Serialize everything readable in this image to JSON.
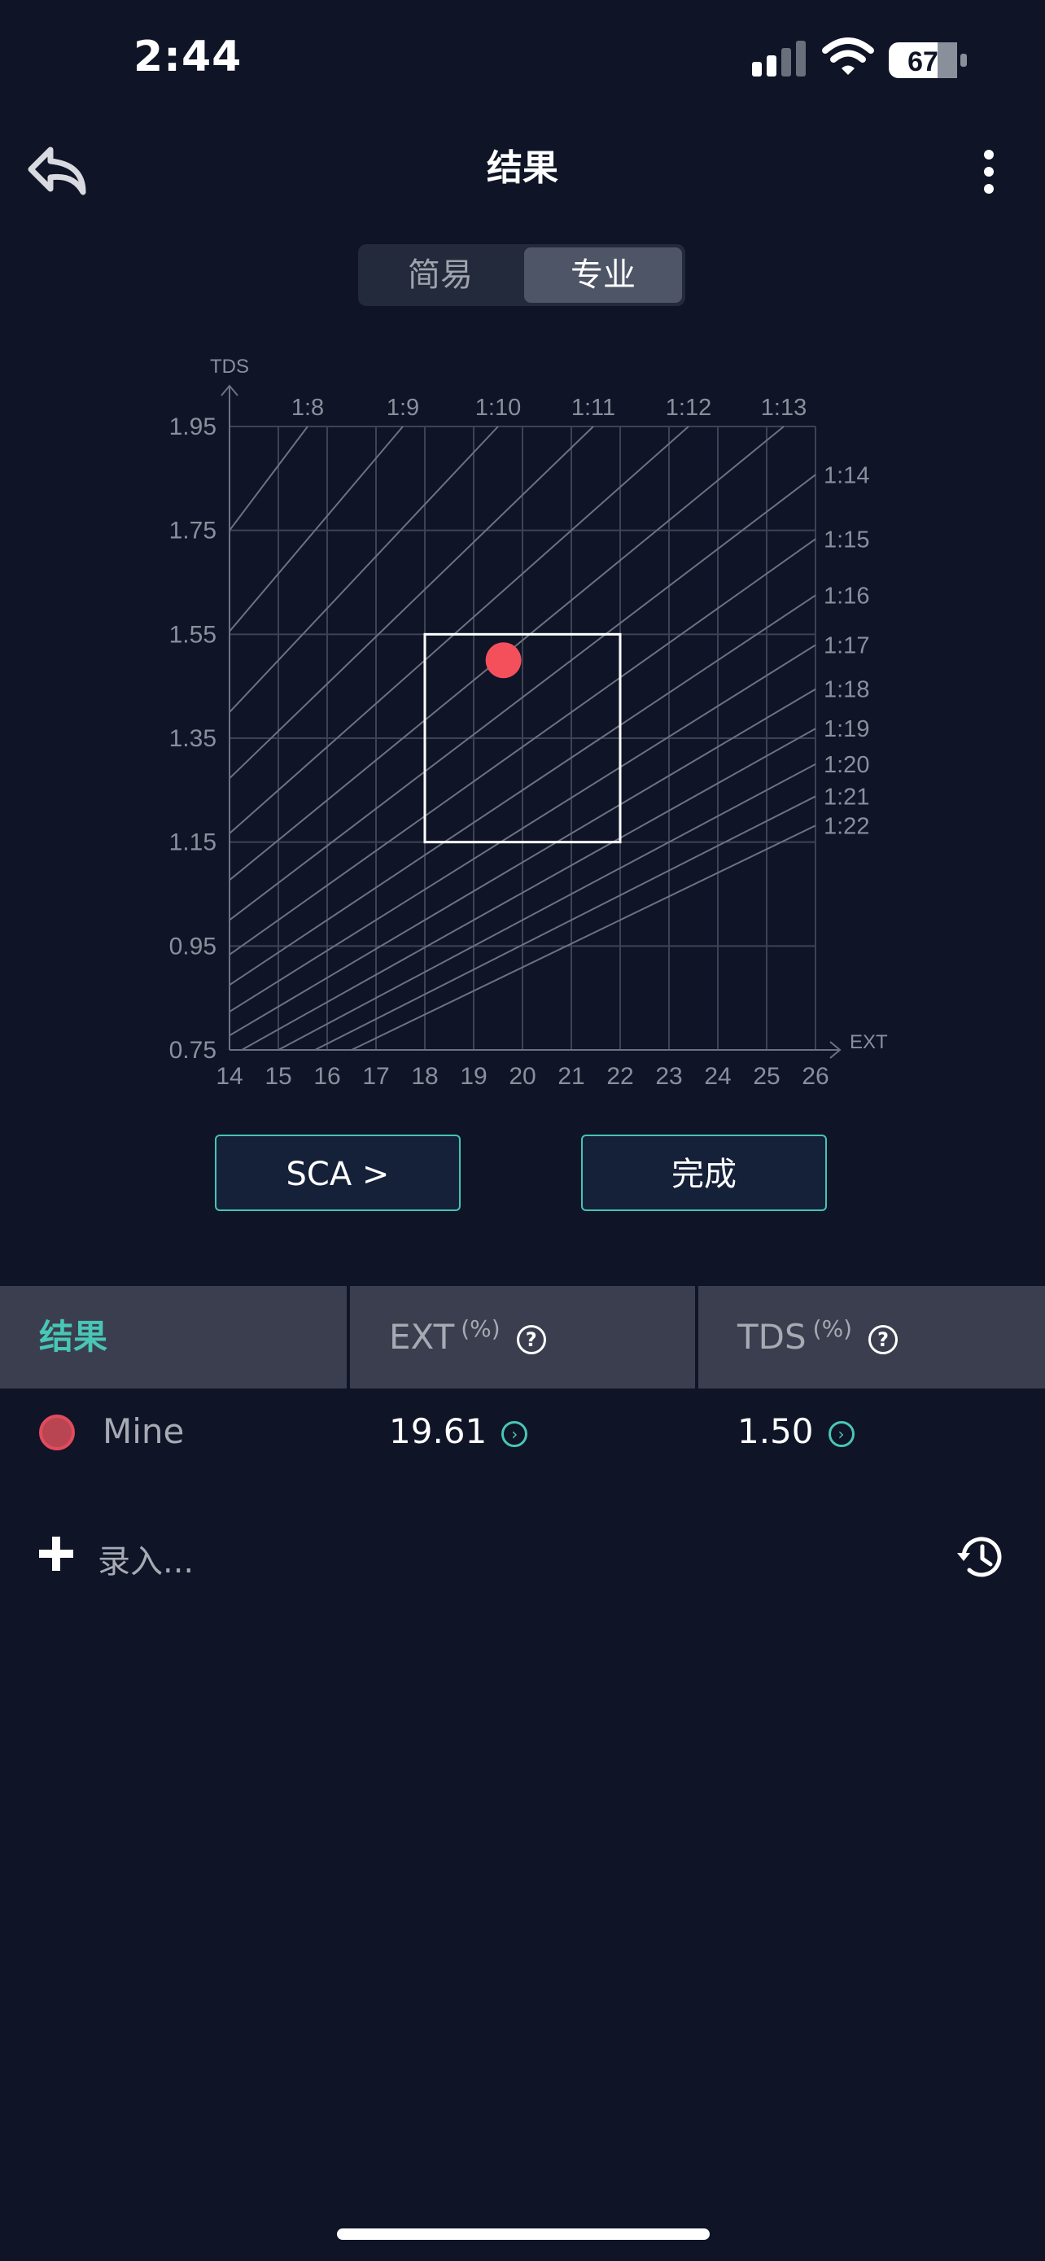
{
  "status_bar": {
    "time": "2:44",
    "battery": "67"
  },
  "header": {
    "title": "结果"
  },
  "segmented": {
    "simple": "简易",
    "pro": "专业",
    "selected": "专业"
  },
  "chart_data": {
    "type": "scatter",
    "xlabel": "EXT",
    "ylabel": "TDS",
    "xlim": [
      14,
      26
    ],
    "ylim": [
      0.75,
      1.95
    ],
    "x_ticks": [
      "14",
      "15",
      "16",
      "17",
      "18",
      "19",
      "20",
      "21",
      "22",
      "23",
      "24",
      "25",
      "26"
    ],
    "y_ticks": [
      "0.75",
      "0.95",
      "1.15",
      "1.35",
      "1.55",
      "1.75",
      "1.95"
    ],
    "ratio_lines": [
      "1:8",
      "1:9",
      "1:10",
      "1:11",
      "1:12",
      "1:13",
      "1:14",
      "1:15",
      "1:16",
      "1:17",
      "1:18",
      "1:19",
      "1:20",
      "1:21",
      "1:22"
    ],
    "target_box": {
      "ext": [
        18,
        22
      ],
      "tds": [
        1.15,
        1.55
      ]
    },
    "points": [
      {
        "name": "Mine",
        "ext": 19.61,
        "tds": 1.5,
        "color": "#f4505c"
      }
    ]
  },
  "buttons": {
    "sca": "SCA >",
    "done": "完成"
  },
  "table": {
    "headers": {
      "result": "结果",
      "ext": "EXT",
      "tds": "TDS",
      "unit": "(%)"
    },
    "rows": [
      {
        "name": "Mine",
        "ext": "19.61",
        "tds": "1.50"
      }
    ]
  },
  "add_entry": {
    "label": "录入..."
  },
  "colors": {
    "accent": "#49c6b6",
    "background": "#0f1427",
    "point": "#f4505c"
  }
}
